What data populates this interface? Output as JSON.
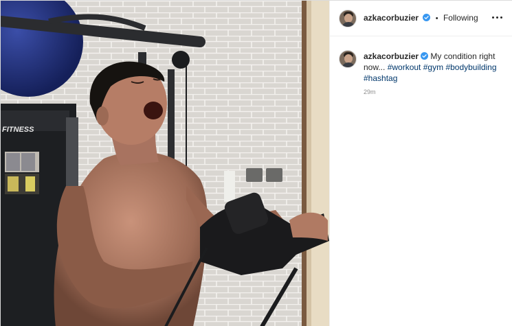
{
  "post": {
    "username": "azkacorbuzier",
    "separator": "•",
    "follow_status": "Following",
    "more_icon": "more-horizontal-icon",
    "caption": {
      "username": "azkacorbuzier",
      "text": "My condition right now...",
      "hashtags": [
        "#workout",
        "#gym",
        "#bodybuilding",
        "#hashtag"
      ],
      "time": "29m"
    },
    "photo": {
      "gym_brand_text": "FITNESS"
    }
  },
  "colors": {
    "verified": "#3897f0",
    "hashtag": "#00376b",
    "muted": "#8e8e8e",
    "border": "#dbdbdb"
  }
}
